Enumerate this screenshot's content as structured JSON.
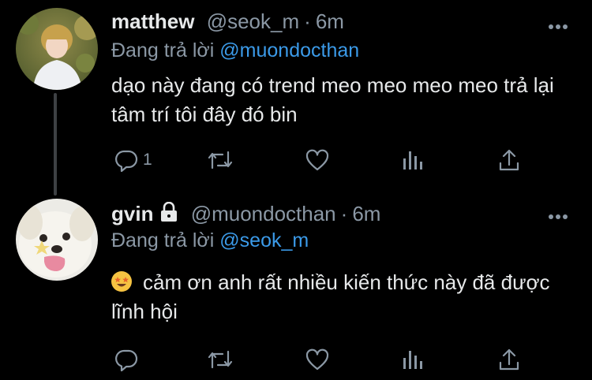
{
  "tweets": [
    {
      "author_name": "matthew",
      "handle": "@seok_m",
      "time": "6m",
      "reply_prefix": "Đang trả lời",
      "reply_to": "@muondocthan",
      "text": "dạo này đang có trend meo meo meo meo trả lại tâm trí tôi đây đó bin",
      "reply_count": "1",
      "locked": false
    },
    {
      "author_name": "gvin",
      "handle": "@muondocthan",
      "time": "6m",
      "reply_prefix": "Đang trả lời",
      "reply_to": "@seok_m",
      "text": "cảm ơn anh rất nhiều kiến thức này đã được lĩnh hội",
      "emoji": "star-struck-emoji",
      "reply_count": "",
      "locked": true
    }
  ],
  "icons": {
    "reply": "reply-icon",
    "retweet": "retweet-icon",
    "like": "heart-icon",
    "analytics": "analytics-icon",
    "share": "share-icon",
    "more": "more-icon",
    "lock": "lock-icon"
  },
  "colors": {
    "background": "#000000",
    "text": "#e7e9ea",
    "muted": "#8b98a5",
    "link": "#3b9ae8",
    "thread_line": "#3e4144"
  }
}
